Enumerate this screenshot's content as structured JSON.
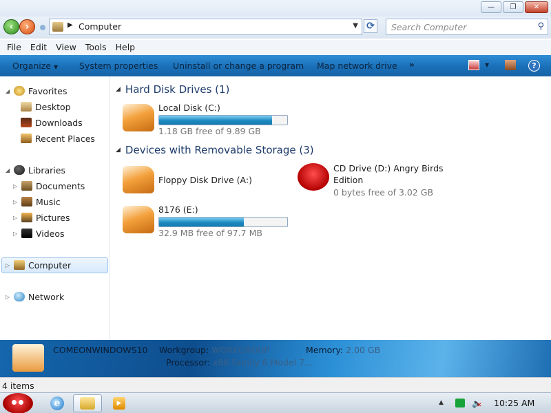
{
  "window": {
    "minimize_glyph": "—",
    "maximize_glyph": "❐",
    "close_glyph": "✕"
  },
  "address": {
    "location": "Computer",
    "search_placeholder": "Search Computer"
  },
  "menu": [
    "File",
    "Edit",
    "View",
    "Tools",
    "Help"
  ],
  "toolbar": {
    "organize": "Organize",
    "system_properties": "System properties",
    "uninstall": "Uninstall or change a program",
    "map_drive": "Map network drive",
    "more": "»"
  },
  "nav": {
    "favorites": "Favorites",
    "desktop": "Desktop",
    "downloads": "Downloads",
    "recent": "Recent Places",
    "libraries": "Libraries",
    "documents": "Documents",
    "music": "Music",
    "pictures": "Pictures",
    "videos": "Videos",
    "computer": "Computer",
    "network": "Network"
  },
  "content": {
    "hdd_group": "Hard Disk Drives (1)",
    "removable_group": "Devices with Removable Storage (3)",
    "drives": {
      "c": {
        "name": "Local Disk (C:)",
        "free": "1.18 GB free of 9.89 GB",
        "used_fraction": 0.88
      },
      "a": {
        "name": "Floppy Disk Drive (A:)"
      },
      "d": {
        "name_line1": "CD Drive (D:) Angry Birds",
        "name_line2": "Edition",
        "free": "0 bytes free of 3.02 GB"
      },
      "e": {
        "name": "8176 (E:)",
        "free": "32.9 MB free of 97.7 MB",
        "used_fraction": 0.66
      }
    }
  },
  "details": {
    "computer_name": "COMEONWINDOWS10",
    "workgroup_label": "Workgroup:",
    "workgroup_value": "WORKGROUP",
    "memory_label": "Memory:",
    "memory_value": "2.00 GB",
    "processor_label": "Processor:",
    "processor_value": "x86 Family 6 Model 7..."
  },
  "status": {
    "items": "4 items"
  },
  "taskbar": {
    "ie_glyph": "e",
    "media_glyph": "▶",
    "tray_up": "▲",
    "tray_mute": "✕",
    "clock": "10:25 AM"
  }
}
